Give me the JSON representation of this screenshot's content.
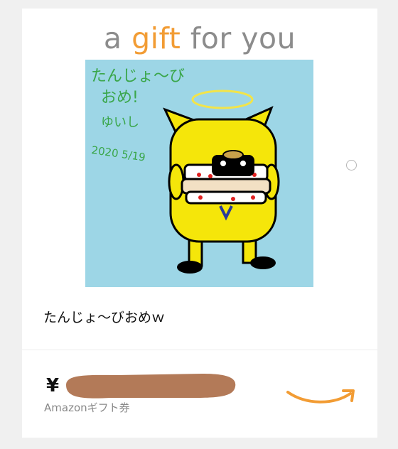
{
  "headline": {
    "word1": "a ",
    "word2": "gift",
    "word3": " for you"
  },
  "artwork": {
    "handwriting_line1": "たんじょ〜び",
    "handwriting_line2": "おめ!",
    "handwriting_line3": "ゆいし",
    "handwriting_date": "2020 5/19"
  },
  "message": "たんじょ〜びおめｗ",
  "gift_card": {
    "currency_symbol": "¥",
    "amount": "",
    "label": "Amazonギフト券"
  },
  "colors": {
    "accent": "#f29c34",
    "headline_gray": "#8c8c8c",
    "art_background": "#9dd6e6",
    "character_yellow": "#f5e60a",
    "handwriting_green": "#3aa64a",
    "redaction_brown": "#b37a58"
  },
  "icons": {
    "select": "radio-circle-icon",
    "brand": "amazon-smile-icon"
  }
}
